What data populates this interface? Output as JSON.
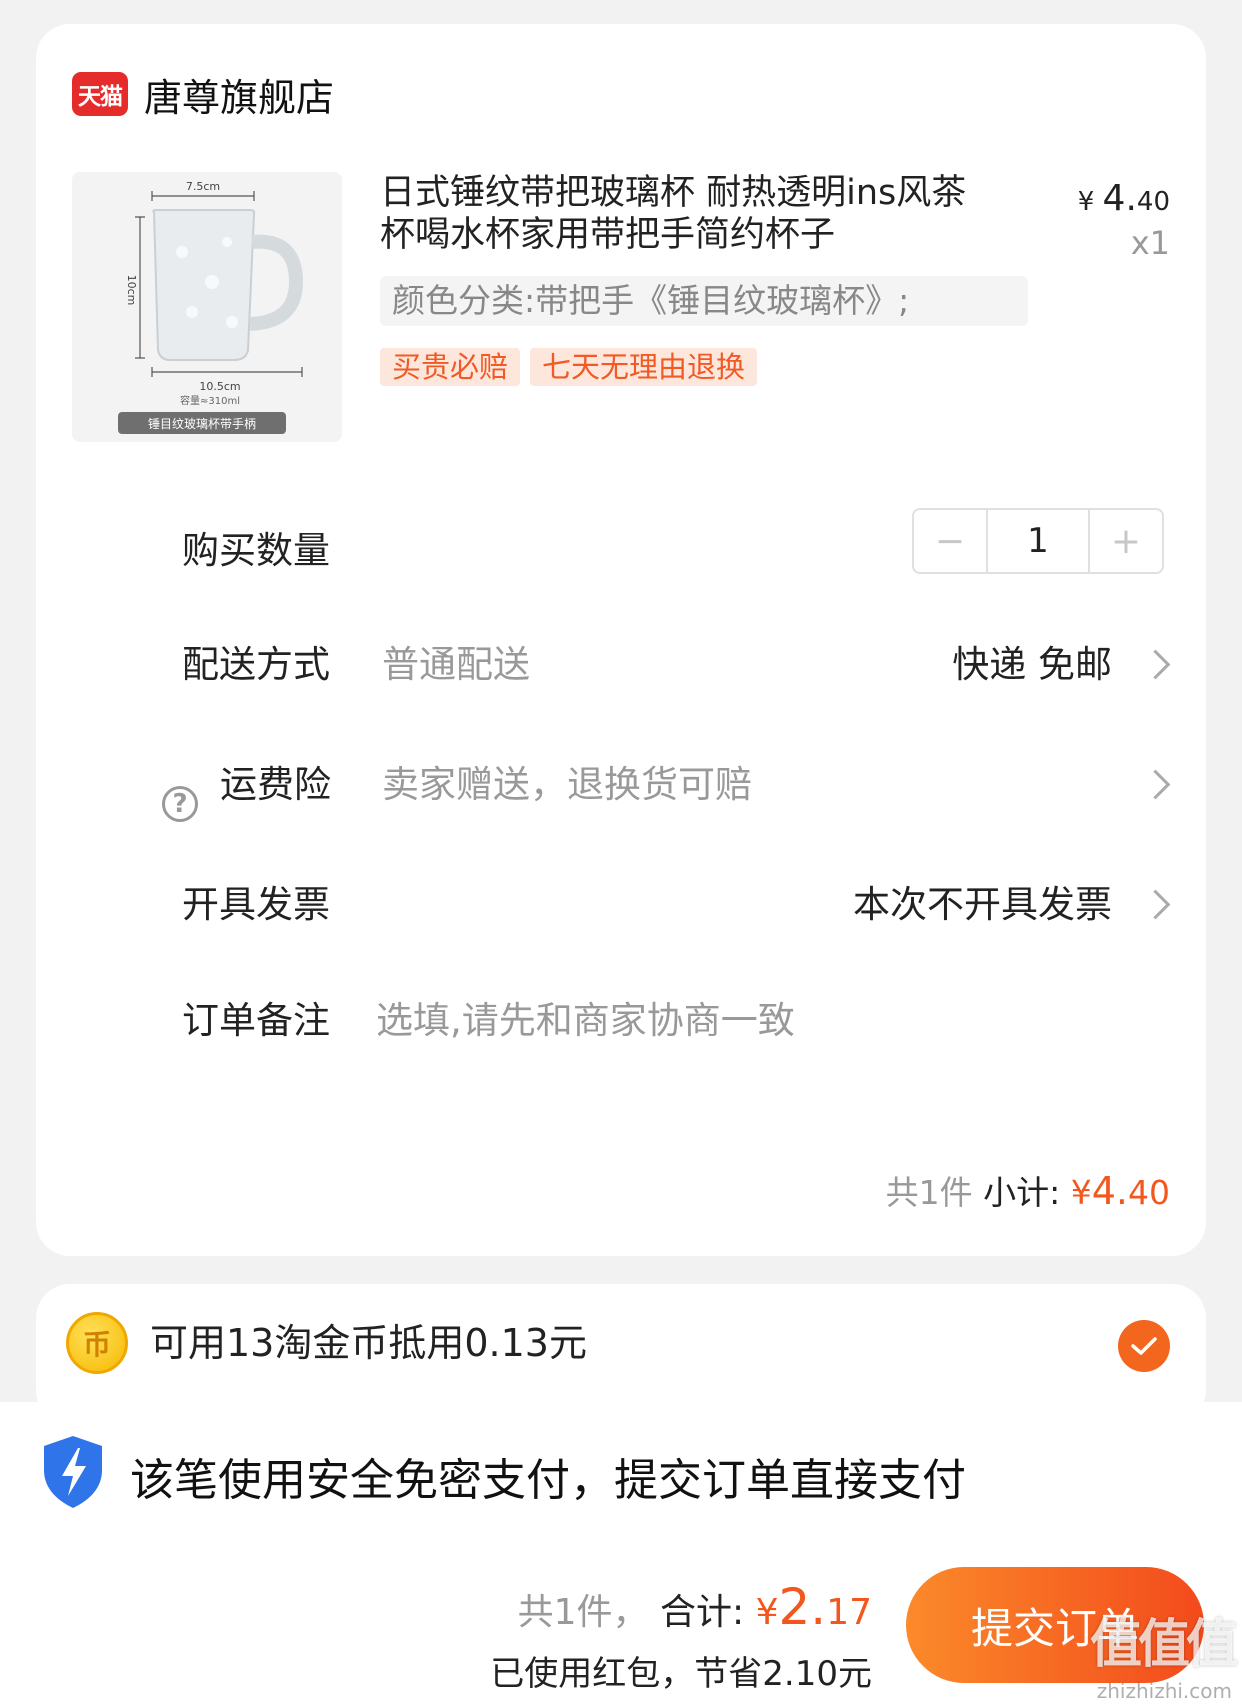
{
  "store": {
    "logo_text": "天猫",
    "name": "唐尊旗舰店"
  },
  "product": {
    "image_width_label": "7.5cm",
    "image_height_label": "10cm",
    "image_bottom_label": "10.5cm",
    "image_capacity_label": "容量≈310ml",
    "image_caption": "锤目纹玻璃杯带手柄",
    "title": "日式锤纹带把玻璃杯 耐热透明ins风茶杯喝水杯家用带把手简约杯子",
    "price_symbol": "¥",
    "price_int": "4.",
    "price_dec": "40",
    "qty_label": "x1",
    "sku": "颜色分类:带把手《锤目纹玻璃杯》;",
    "tags": [
      "买贵必赔",
      "七天无理由退换"
    ]
  },
  "rows": {
    "quantity": {
      "label": "购买数量",
      "minus": "−",
      "value": "1",
      "plus": "+"
    },
    "delivery": {
      "label": "配送方式",
      "sub": "普通配送",
      "value": "快递 免邮"
    },
    "insurance": {
      "icon": "?",
      "label": "运费险",
      "sub": "卖家赠送，退换货可赔"
    },
    "invoice": {
      "label": "开具发票",
      "value": "本次不开具发票"
    },
    "note": {
      "label": "订单备注",
      "placeholder": "选填,请先和商家协商一致"
    }
  },
  "subtotal": {
    "count": "共1件",
    "label": "小计:",
    "symbol": "¥",
    "int": "4.",
    "dec": "40"
  },
  "coin": {
    "icon_text": "币",
    "text": "可用13淘金币抵用0.13元"
  },
  "secure": {
    "text": "该笔使用安全免密支付，提交订单直接支付"
  },
  "total": {
    "count": "共1件，",
    "label": "合计:",
    "symbol": "¥",
    "int": "2.",
    "dec": "17",
    "saving": "已使用红包，节省2.10元"
  },
  "submit_label": "提交订单",
  "watermark": {
    "text": "值值值",
    "url": "zhizhizhi.com"
  },
  "colors": {
    "accent": "#f2581e",
    "tag_bg": "#fde7dd",
    "tmall_red": "#e62b2b",
    "shield_blue": "#2f74e8"
  }
}
